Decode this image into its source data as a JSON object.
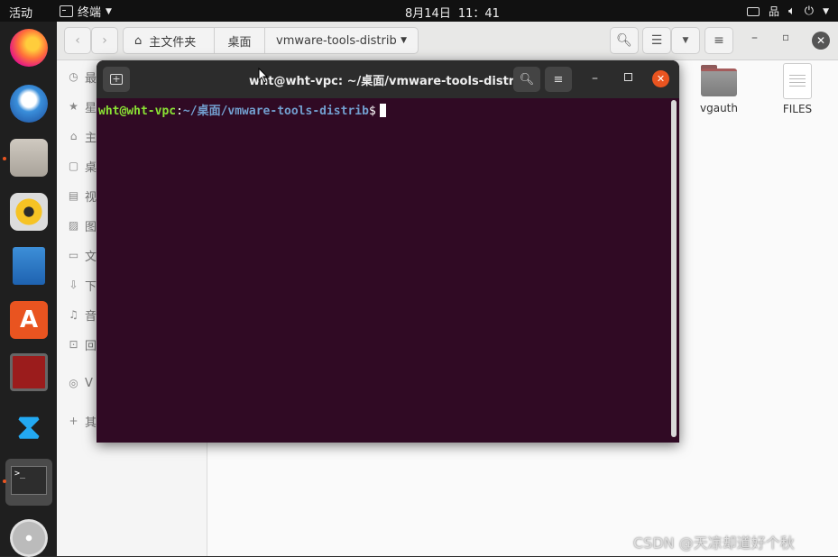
{
  "topbar": {
    "activities": "活动",
    "app_name": "终端",
    "date": "8月14日",
    "time": "11：41"
  },
  "dock": {
    "items": [
      "firefox-icon",
      "thunderbird-icon",
      "files-icon",
      "rhythmbox-icon",
      "libreoffice-writer-icon",
      "software-center-icon",
      "remote-desktop-icon",
      "vscode-icon",
      "terminal-icon",
      "dvd-icon"
    ]
  },
  "nautilus": {
    "breadcrumbs": [
      "主文件夹",
      "桌面",
      "vmware-tools-distrib"
    ],
    "sidebar": [
      "最",
      "星",
      "主",
      "桌",
      "视",
      "图",
      "文",
      "下",
      "音",
      "回",
      "V",
      "其"
    ],
    "files": [
      {
        "name": "vgauth",
        "icon": "folder-icon"
      },
      {
        "name": "FILES",
        "icon": "text-file-icon"
      }
    ]
  },
  "terminal": {
    "title": "wht@wht-vpc: ~/桌面/vmware-tools-distrib",
    "prompt_user": "wht@wht-vpc",
    "prompt_sep": ":",
    "prompt_path": "~/桌面/vmware-tools-distrib",
    "prompt_symbol": "$"
  },
  "watermark": "CSDN @天凉却道好个秋",
  "colors": {
    "terminal_bg": "#300a24",
    "prompt_user": "#8ae234",
    "prompt_path": "#729fcf",
    "accent": "#e95420"
  }
}
